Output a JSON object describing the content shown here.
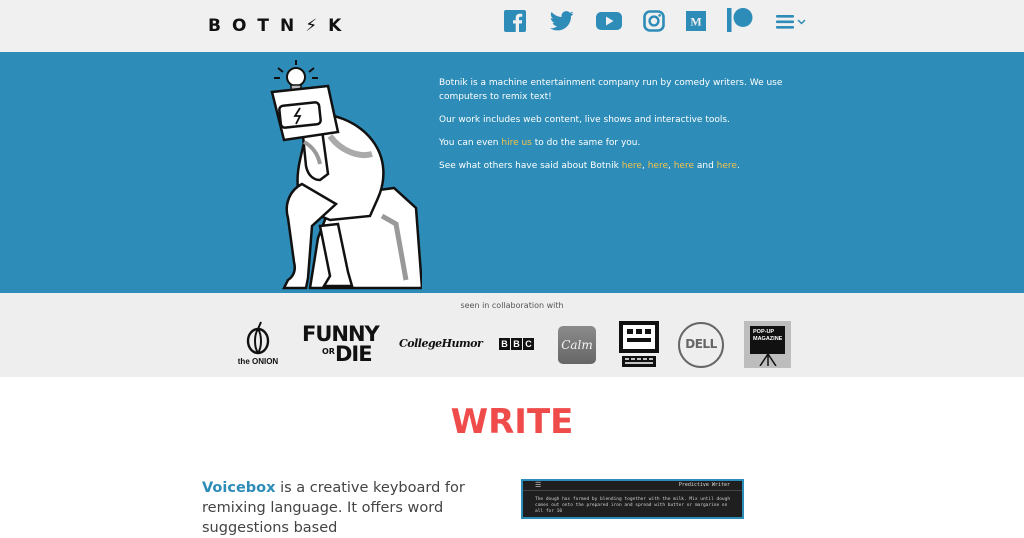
{
  "header": {
    "logo": "BOTN⚡K",
    "social": [
      "facebook-icon",
      "twitter-icon",
      "youtube-icon",
      "instagram-icon",
      "medium-icon",
      "patreon-icon",
      "menu-icon"
    ]
  },
  "hero": {
    "p1": "Botnik is a machine entertainment company run by comedy writers. We use computers to remix text!",
    "p2": "Our work includes web content, live shows and interactive tools.",
    "p3_pre": "You can even ",
    "p3_link": "hire us",
    "p3_post": " to do the same for you.",
    "p4_pre": "See what others have said about Botnik ",
    "p4_l1": "here",
    "p4_sep1": ", ",
    "p4_l2": "here",
    "p4_sep2": ", ",
    "p4_l3": "here",
    "p4_and": " and ",
    "p4_l4": "here",
    "p4_end": "."
  },
  "collab": {
    "label": "seen in collaboration with",
    "onion": "the ONION",
    "funny1": "FUNNY",
    "funny_or": "OR",
    "funny2": "DIE",
    "college": "CollegeHumor",
    "bbc": [
      "B",
      "B",
      "C"
    ],
    "calm": "Calm",
    "dell": "DELL",
    "popup": "POP-UP MAGAZINE"
  },
  "section": {
    "title": "WRITE",
    "voicebox_name": "Voicebox",
    "voicebox_text": " is a creative keyboard for remixing language. It offers word suggestions based",
    "screen_title": "Predictive Writer",
    "screen_text": "The dough has formed by blending together with the milk. Mix until dough comes out onto the prepared iron and spread with butter or margarine on all for 10"
  }
}
